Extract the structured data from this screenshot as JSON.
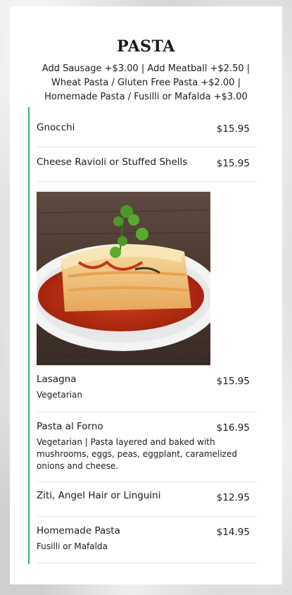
{
  "section": {
    "title": "PASTA",
    "description": "Add Sausage +$3.00 | Add Meatball +$2.50 | Wheat Pasta / Gluten Free Pasta +$2.00 | Homemade Pasta / Fusilli or Mafalda +$3.00"
  },
  "items": [
    {
      "name": "Gnocchi",
      "price": "$15.95"
    },
    {
      "name": "Cheese Ravioli or Stuffed Shells",
      "price": "$15.95"
    },
    {
      "name": "Lasagna",
      "price": "$15.95",
      "description": "Vegetarian"
    },
    {
      "name": "Pasta al Forno",
      "price": "$16.95",
      "description": "Vegetarian | Pasta layered and baked with mushrooms, eggs, peas, eggplant, caramelized onions and cheese."
    },
    {
      "name": "Ziti, Angel Hair or Linguini",
      "price": "$12.95"
    },
    {
      "name": "Homemade Pasta",
      "price": "$14.95",
      "description": "Fusilli or Mafalda"
    }
  ],
  "colors": {
    "accent_border": "#3fb168",
    "divider": "#e6e6e6"
  }
}
